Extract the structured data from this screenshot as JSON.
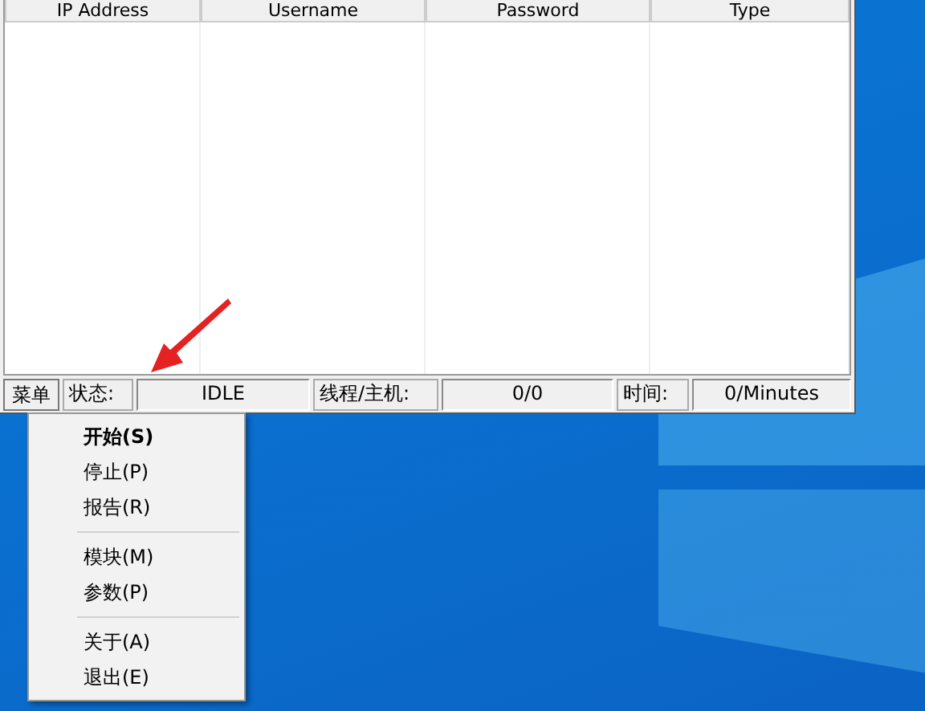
{
  "table": {
    "columns": [
      "IP Address",
      "Username",
      "Password",
      "Type"
    ]
  },
  "status_bar": {
    "menu_button": "菜单",
    "status_label": "状态:",
    "status_value": "IDLE",
    "threads_label": "线程/主机:",
    "threads_value": "0/0",
    "time_label": "时间:",
    "time_value": "0/Minutes"
  },
  "context_menu": {
    "items": [
      {
        "kind": "item",
        "label": "开始(S)",
        "default": true
      },
      {
        "kind": "item",
        "label": "停止(P)",
        "default": false
      },
      {
        "kind": "item",
        "label": "报告(R)",
        "default": false
      },
      {
        "kind": "separator"
      },
      {
        "kind": "item",
        "label": "模块(M)",
        "default": false
      },
      {
        "kind": "item",
        "label": "参数(P)",
        "default": false
      },
      {
        "kind": "separator"
      },
      {
        "kind": "item",
        "label": "关于(A)",
        "default": false
      },
      {
        "kind": "item",
        "label": "退出(E)",
        "default": false
      }
    ]
  }
}
